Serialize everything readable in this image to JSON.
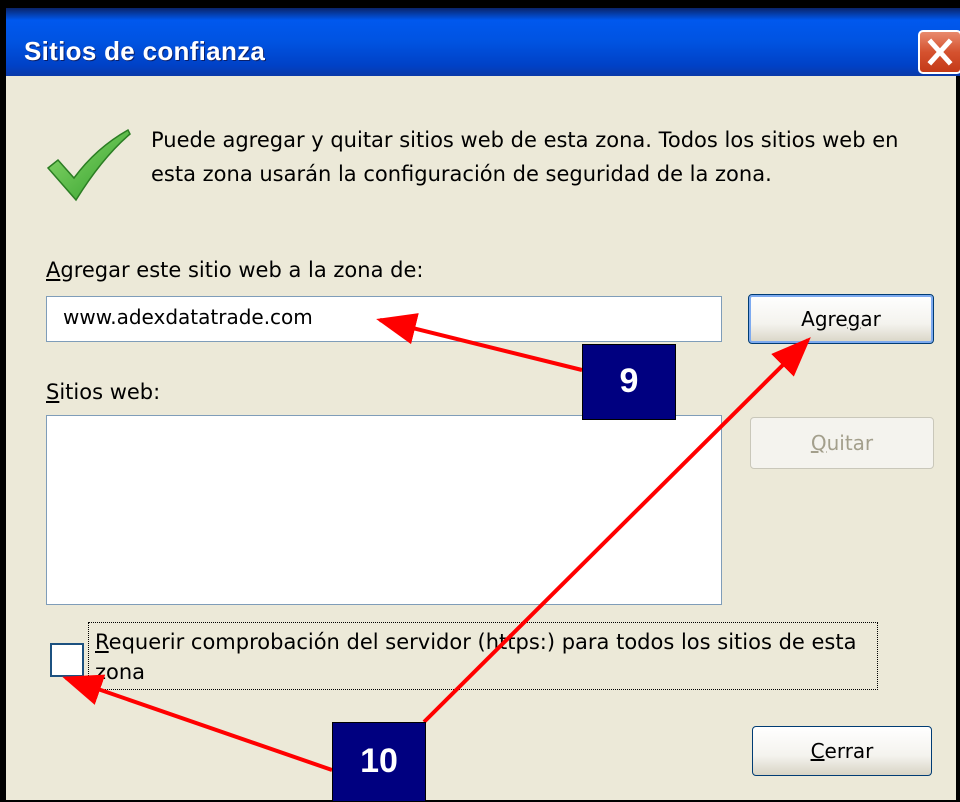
{
  "window": {
    "title": "Sitios de confianza"
  },
  "description": "Puede agregar y quitar sitios web de esta zona. Todos los sitios web en esta zona usarán la configuración de seguridad de la zona.",
  "add_site": {
    "label_accel": "A",
    "label_rest": "gregar este sitio web a la zona de:",
    "value": "www.adexdatatrade.com",
    "button_pre": "Agre",
    "button_accel": "g",
    "button_post": "ar"
  },
  "websites": {
    "label_accel": "S",
    "label_rest": "itios web:",
    "remove_accel": "Q",
    "remove_rest": "uitar",
    "items": []
  },
  "https_check": {
    "label_accel": "R",
    "label_rest": "equerir comprobación del servidor (https:) para todos los sitios de esta zona",
    "checked": false
  },
  "close_button": {
    "accel": "C",
    "rest": "errar"
  },
  "annotations": {
    "step1": "9",
    "step2": "10",
    "arrow_color": "#ff0000"
  },
  "icons": {
    "checkmark": "green-check-icon",
    "close": "close-icon"
  }
}
